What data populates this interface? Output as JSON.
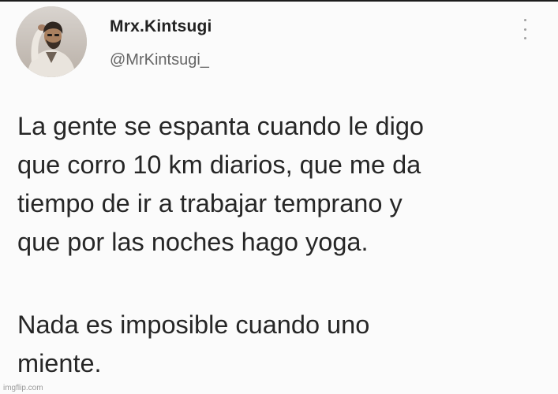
{
  "tweet": {
    "display_name": "Mrx.Kintsugi",
    "username": "@MrKintsugi_",
    "paragraph_1": [
      "La gente se espanta cuando le digo",
      "que corro 10 km diarios, que me da",
      "tiempo de ir a trabajar temprano y",
      "que por las noches hago yoga."
    ],
    "paragraph_2": [
      "Nada es imposible cuando uno",
      "miente."
    ]
  },
  "watermark": "imgflip.com",
  "icons": {
    "more": "more-vertical-icon",
    "avatar": "profile-avatar"
  }
}
